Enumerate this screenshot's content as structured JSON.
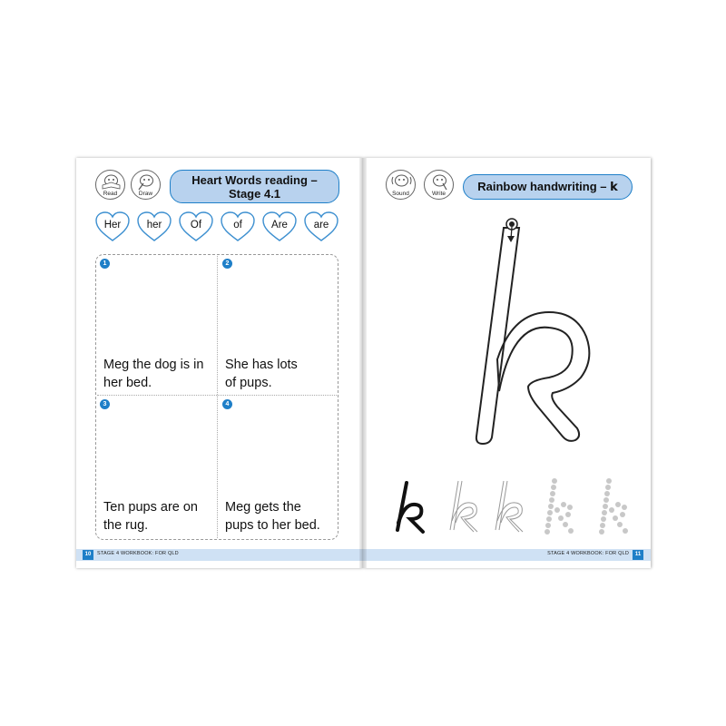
{
  "left_page": {
    "icons": [
      {
        "name": "read",
        "label": "Read"
      },
      {
        "name": "draw",
        "label": "Draw"
      }
    ],
    "title_line1": "Heart Words reading –",
    "title_line2": "Stage 4.1",
    "heart_words": [
      "Her",
      "her",
      "Of",
      "of",
      "Are",
      "are"
    ],
    "panels": [
      {
        "number": "1",
        "line1": "Meg the dog is in",
        "line2": "her bed."
      },
      {
        "number": "2",
        "line1": "She has lots",
        "line2": "of pups."
      },
      {
        "number": "3",
        "line1": "Ten pups are on",
        "line2": "the rug."
      },
      {
        "number": "4",
        "line1": "Meg gets the",
        "line2": "pups to her bed."
      }
    ],
    "footer": {
      "page_number": "10",
      "text": "STAGE 4 WORKBOOK: FOR QLD"
    }
  },
  "right_page": {
    "icons": [
      {
        "name": "sound",
        "label": "Sound"
      },
      {
        "name": "write",
        "label": "Write"
      }
    ],
    "title": "Rainbow handwriting –",
    "title_letter": "k",
    "big_letter_icon": "letter-k-outline",
    "practice_letters": [
      "solid-k",
      "outline-k",
      "outline-k",
      "dotted-k",
      "dotted-k"
    ],
    "footer": {
      "page_number": "11",
      "text": "STAGE 4 WORKBOOK: FOR QLD"
    }
  },
  "colors": {
    "accent_blue": "#1e7fc8",
    "pill_fill": "#b8d2ee",
    "heart_border": "#3c8fd0",
    "footer_band": "#cfe1f4"
  }
}
